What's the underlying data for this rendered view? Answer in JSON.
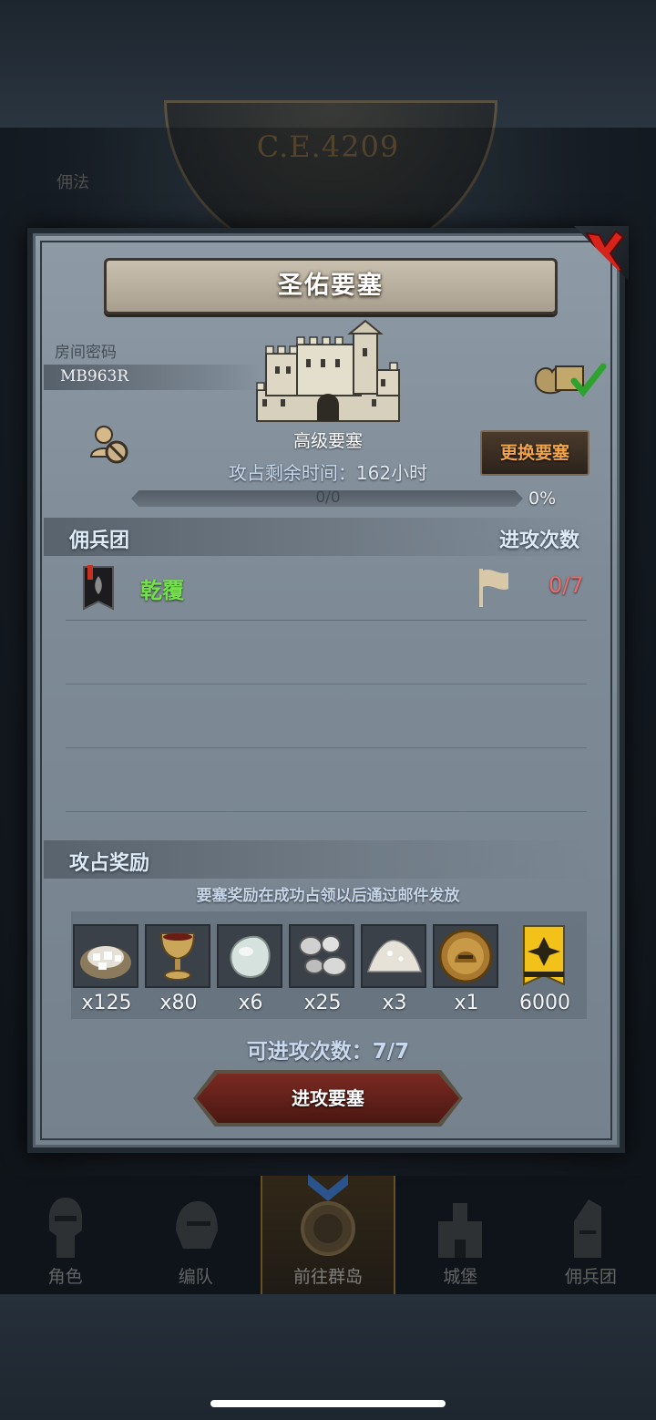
{
  "background": {
    "year_text": "C.E.4209",
    "corner_text": "佣法"
  },
  "modal": {
    "title": "圣佑要塞",
    "room": {
      "label": "房间密码",
      "code": "MB963R"
    },
    "fortress_level": "高级要塞",
    "time": {
      "label": "攻占剩余时间：",
      "value": "162小时"
    },
    "change_button": "更换要塞",
    "progress": {
      "text": "0/0",
      "percent_label": "0%",
      "fraction": 0
    },
    "mercenary_section": {
      "title": "佣兵团",
      "right_title": "进攻次数",
      "rows": [
        {
          "name": "乾覆",
          "count": "0/7"
        }
      ]
    },
    "reward_section": {
      "title": "攻占奖励",
      "note": "要塞奖励在成功占领以后通过邮件发放",
      "items": [
        {
          "icon": "ore-sack-icon",
          "qty": "x125"
        },
        {
          "icon": "goblet-icon",
          "qty": "x80"
        },
        {
          "icon": "gem-icon",
          "qty": "x6"
        },
        {
          "icon": "silver-ore-icon",
          "qty": "x25"
        },
        {
          "icon": "powder-icon",
          "qty": "x3"
        },
        {
          "icon": "helmet-medal-icon",
          "qty": "x1"
        },
        {
          "icon": "guild-banner-icon",
          "qty": "6000"
        }
      ]
    },
    "attempts": "可进攻次数：7/7",
    "attack_button": "进攻要塞"
  },
  "nav": {
    "items": [
      {
        "label": "角色",
        "icon": "knight-icon"
      },
      {
        "label": "编队",
        "icon": "helmet-icon"
      },
      {
        "label": "前往群岛",
        "icon": "compass-icon"
      },
      {
        "label": "城堡",
        "icon": "castle-icon"
      },
      {
        "label": "佣兵团",
        "icon": "mercenary-icon"
      }
    ]
  },
  "colors": {
    "merc_name": "#74e04d",
    "attack_count": "#ec6c6c",
    "change_button_text": "#f2a44a",
    "attack_button": "#7a2a22"
  }
}
